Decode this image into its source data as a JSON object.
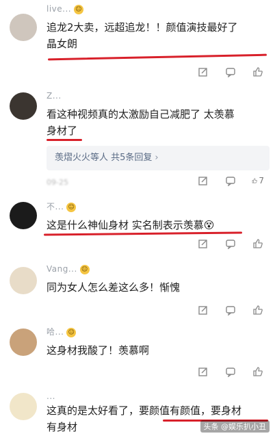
{
  "comments": [
    {
      "user": "live...",
      "text1": "追龙2大卖，远超追龙！！颜值演技最好了",
      "text2": "晶女朗",
      "time": ""
    },
    {
      "user": "Z...",
      "text1": "看这种视频真的太激励自己减肥了 太羡慕",
      "text2": "身材了",
      "time": "09-25",
      "replies_label": "羡熠火火等人 共5条回复",
      "replies_chevron": "›",
      "likes": "7"
    },
    {
      "user": "不...",
      "text1": "这是什么神仙身材  实名制表示羡慕😵",
      "text2": ""
    },
    {
      "user": "Vang...",
      "text1": "同为女人怎么差这么多！惭愧",
      "text2": ""
    },
    {
      "user": "哈...",
      "text1": "这身材我酸了！羡慕啊",
      "text2": ""
    },
    {
      "user": "...",
      "text1": "这真的是太好看了，要颜值有颜值，要身材",
      "text2": "有身材"
    }
  ],
  "icons": {
    "share": "share-icon",
    "comment": "comment-icon",
    "like": "thumbs-up-icon"
  },
  "watermark": "头条 @娱乐扒小丑"
}
